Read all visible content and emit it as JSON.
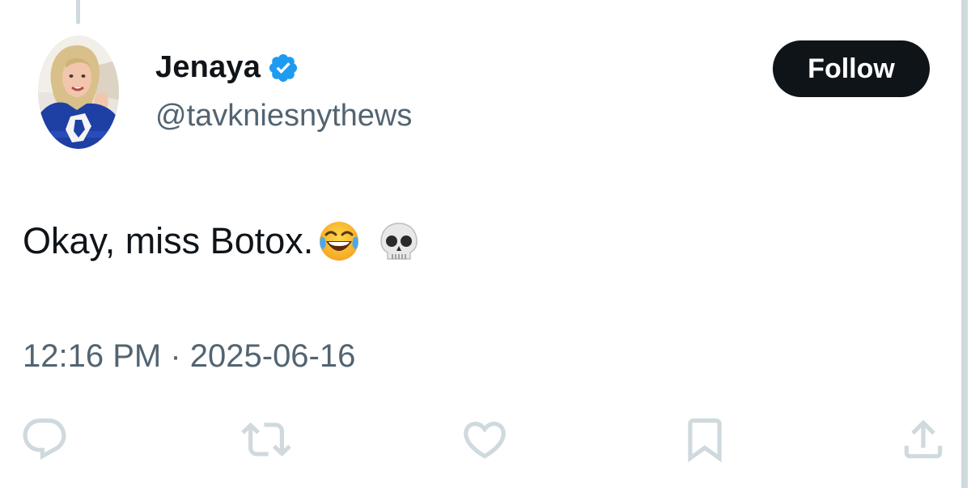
{
  "tweet": {
    "author": {
      "display_name": "Jenaya",
      "handle": "@tavkniesnythews",
      "verified": true,
      "verified_color": "#1d9bf0",
      "avatar_icon": "profile-photo"
    },
    "follow_label": "Follow",
    "text": "Okay, miss Botox.",
    "emojis": [
      "tears-of-joy-emoji",
      "skull-emoji"
    ],
    "timestamp": "12:16 PM · 2025-06-16",
    "actions": [
      "reply-icon",
      "retweet-icon",
      "like-icon",
      "bookmark-icon",
      "share-icon"
    ]
  },
  "colors": {
    "text_primary": "#0f1419",
    "text_secondary": "#536471",
    "button_bg": "#0f1419",
    "icon_muted": "#cfd9de"
  }
}
